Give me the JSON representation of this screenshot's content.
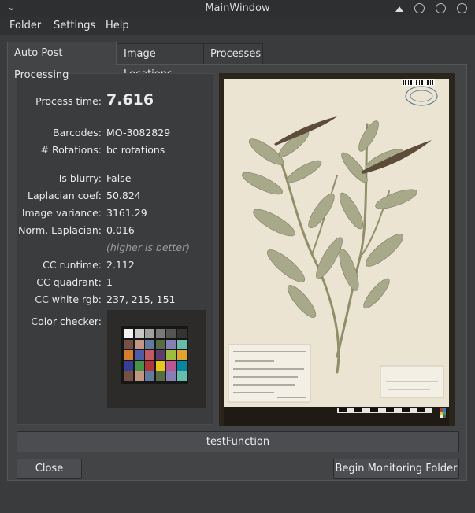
{
  "window": {
    "title": "MainWindow"
  },
  "menu": [
    "Folder",
    "Settings",
    "Help"
  ],
  "tabs": [
    "Auto Post Processing",
    "Image Locations",
    "Processes"
  ],
  "fields": {
    "process_time": {
      "label": "Process time:",
      "value": "7.616"
    },
    "barcodes": {
      "label": "Barcodes:",
      "value": "MO-3082829"
    },
    "rotations": {
      "label": "# Rotations:",
      "value": "bc rotations"
    },
    "is_blurry": {
      "label": "Is blurry:",
      "value": "False"
    },
    "laplacian_coef": {
      "label": "Laplacian coef:",
      "value": "50.824"
    },
    "image_variance": {
      "label": "Image variance:",
      "value": "3161.29"
    },
    "norm_laplacian": {
      "label": "Norm. Laplacian:",
      "value": "0.016",
      "hint": "(higher is better)"
    },
    "cc_runtime": {
      "label": "CC runtime:",
      "value": "2.112"
    },
    "cc_quadrant": {
      "label": "CC quadrant:",
      "value": "1"
    },
    "cc_white_rgb": {
      "label": "CC white rgb:",
      "value": "237, 215, 151"
    },
    "color_checker": {
      "label": "Color checker:"
    }
  },
  "buttons": {
    "test": "testFunction",
    "close": "Close",
    "monitor": "Begin Monitoring Folder"
  },
  "colors": {
    "background": "#3a3b3d",
    "panel": "#434446",
    "button": "#4c4d50",
    "specimen_paper": "#ebe4d2"
  }
}
